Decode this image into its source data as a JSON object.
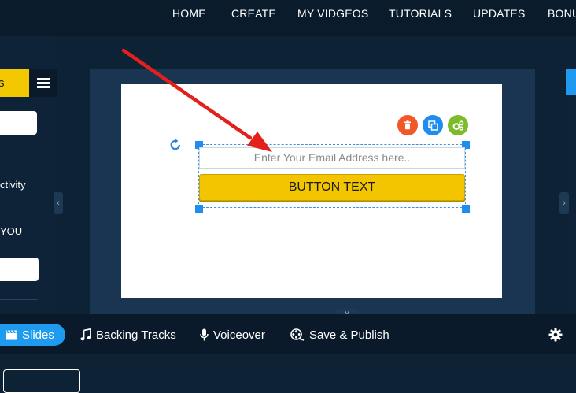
{
  "nav": {
    "items": [
      "HOME",
      "CREATE",
      "MY VIDGEOS",
      "TUTORIALS",
      "UPDATES",
      "BONU"
    ]
  },
  "left_panel": {
    "tab_label": "s",
    "text_1": "ctivity",
    "text_2": "YOU"
  },
  "canvas": {
    "email_placeholder": "Enter Your Email Address here..",
    "button_text": "BUTTON TEXT"
  },
  "toolbar": {
    "slides": "Slides",
    "backing_tracks": "Backing Tracks",
    "voiceover": "Voiceover",
    "save_publish": "Save & Publish"
  },
  "colors": {
    "accent": "#1e9bef",
    "cta": "#f2c500",
    "delete": "#f0582a",
    "duplicate": "#1f8df0",
    "settings": "#7dbb2b",
    "arrow": "#e3201b"
  },
  "icons": {
    "delete": "trash-icon",
    "duplicate": "copy-icon",
    "settings": "gears-icon",
    "rotate": "rotate-icon",
    "slides": "clapperboard-icon",
    "backing": "music-note-icon",
    "voice": "microphone-icon",
    "save": "film-reel-icon",
    "gear": "gear-icon"
  }
}
